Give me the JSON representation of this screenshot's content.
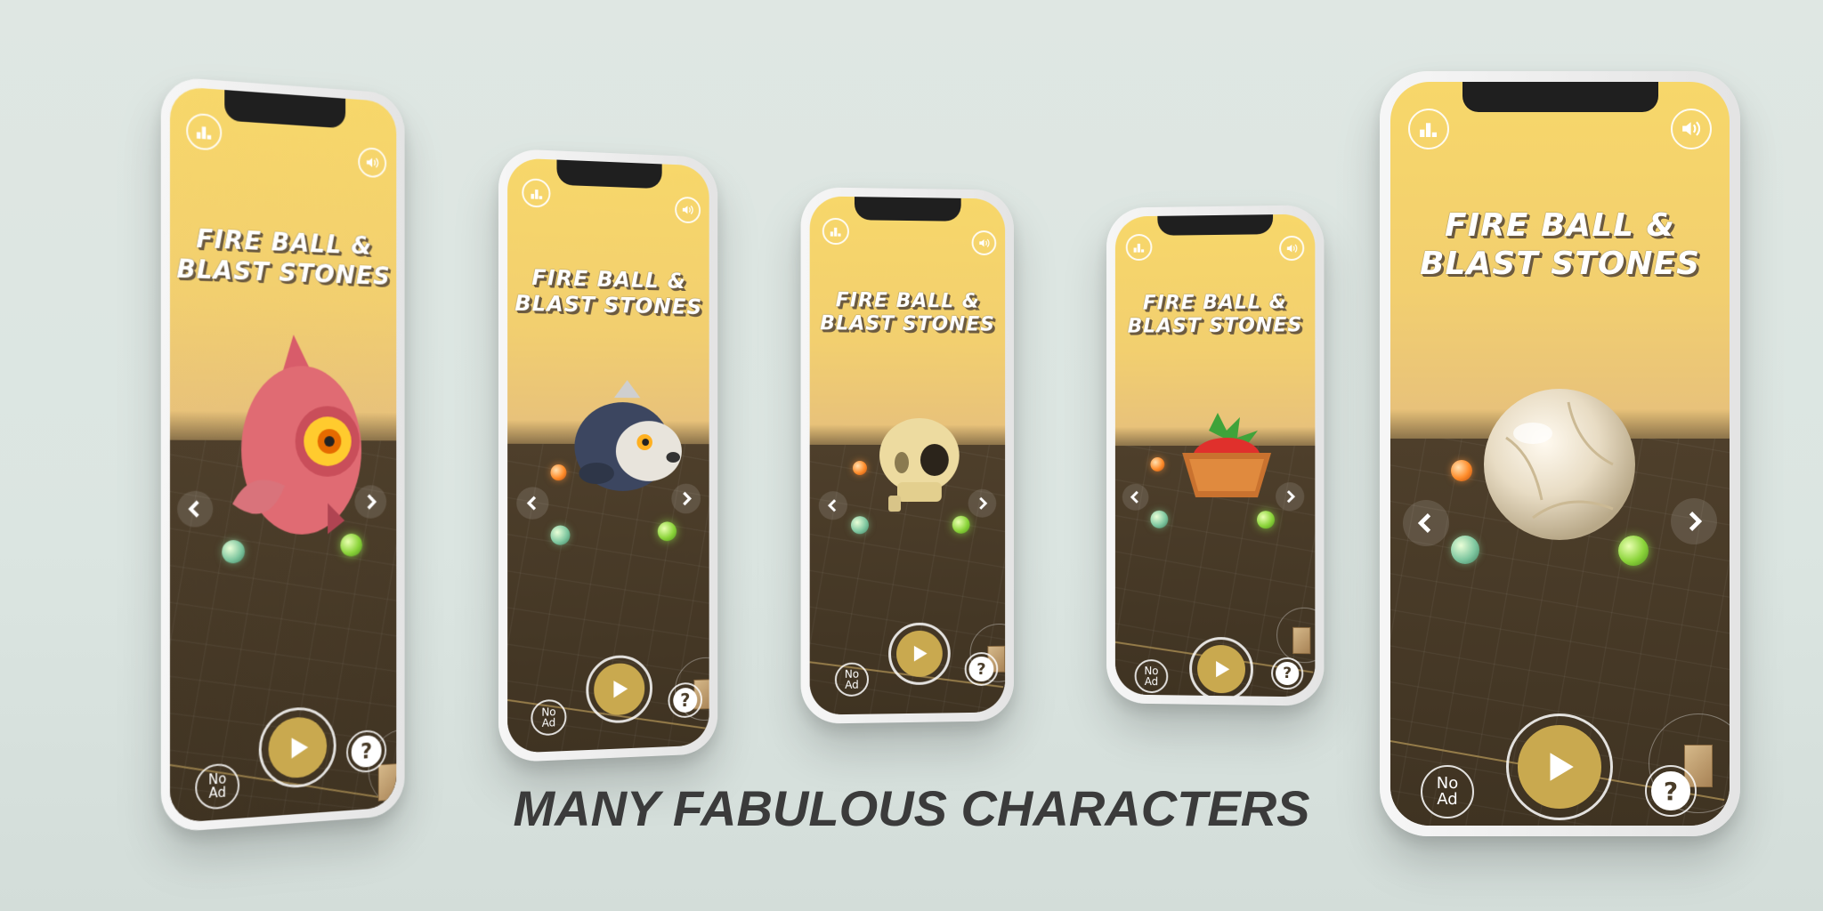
{
  "app": {
    "title_line1": "FIRE BALL &",
    "title_line2": "BLAST STONES",
    "noad_line1": "No",
    "noad_line2": "Ad",
    "help_label": "?",
    "icons": {
      "leaderboard": "leaderboard-icon",
      "sound": "speaker-icon",
      "prev": "chevron-left-icon",
      "next": "chevron-right-icon",
      "play": "play-icon"
    }
  },
  "characters": [
    "pink fish monster",
    "wolf",
    "skull",
    "strawberry basket",
    "crystal ball"
  ],
  "tagline": "MANY FABULOUS CHARACTERS",
  "colors": {
    "sky": "#f7d76a",
    "floor": "#4a3c28",
    "play_fill": "#c9a94f",
    "tagline": "#3b3b3b",
    "background": "#dfe7e3"
  }
}
